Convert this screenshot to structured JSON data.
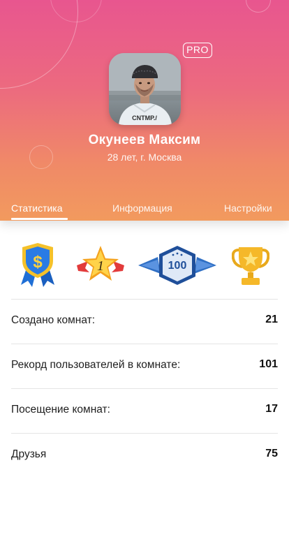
{
  "profile": {
    "name": "Окунеев Максим",
    "subtitle": "28 лет, г. Москва",
    "badge": "PRO",
    "shirt_text": "CNTMP./"
  },
  "tabs": [
    {
      "label": "Статистика",
      "active": true
    },
    {
      "label": "Информация",
      "active": false
    },
    {
      "label": "Настройки",
      "active": false
    }
  ],
  "achievements": [
    {
      "icon": "dollar-ribbon-award-icon"
    },
    {
      "icon": "star-number-one-icon",
      "text": "1"
    },
    {
      "icon": "hundred-winged-badge-icon",
      "text": "100"
    },
    {
      "icon": "gold-trophy-icon"
    }
  ],
  "stats": [
    {
      "label": "Создано комнат:",
      "value": "21"
    },
    {
      "label": "Рекорд пользователей в комнате:",
      "value": "101"
    },
    {
      "label": "Посещение комнат:",
      "value": "17"
    },
    {
      "label": "Друзья",
      "value": "75"
    }
  ],
  "colors": {
    "gradient_top": "#e8568f",
    "gradient_bottom": "#f29a5e",
    "text": "#1a1a1a",
    "divider": "#e4e4e4"
  }
}
